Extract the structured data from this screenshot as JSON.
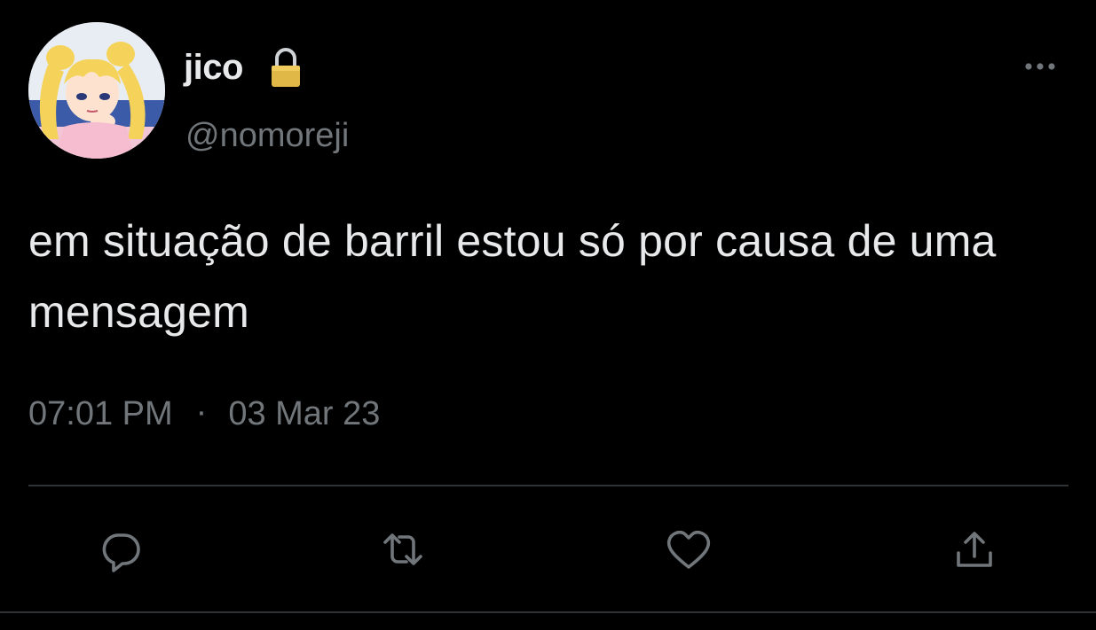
{
  "user": {
    "display_name": "jico",
    "handle": "@nomoreji",
    "protected_icon": "lock-icon",
    "avatar": "avatar-image"
  },
  "tweet": {
    "text": "em situação de barril estou só por causa de uma mensagem",
    "time": "07:01 PM",
    "separator": "·",
    "date": "03 Mar 23"
  },
  "actions": [
    {
      "name": "reply",
      "icon": "reply-icon"
    },
    {
      "name": "retweet",
      "icon": "retweet-icon"
    },
    {
      "name": "like",
      "icon": "heart-icon"
    },
    {
      "name": "share",
      "icon": "share-icon"
    }
  ],
  "colors": {
    "background": "#000000",
    "primary_text": "#e7e9ea",
    "secondary_text": "#71767b",
    "divider": "#2f3336"
  }
}
